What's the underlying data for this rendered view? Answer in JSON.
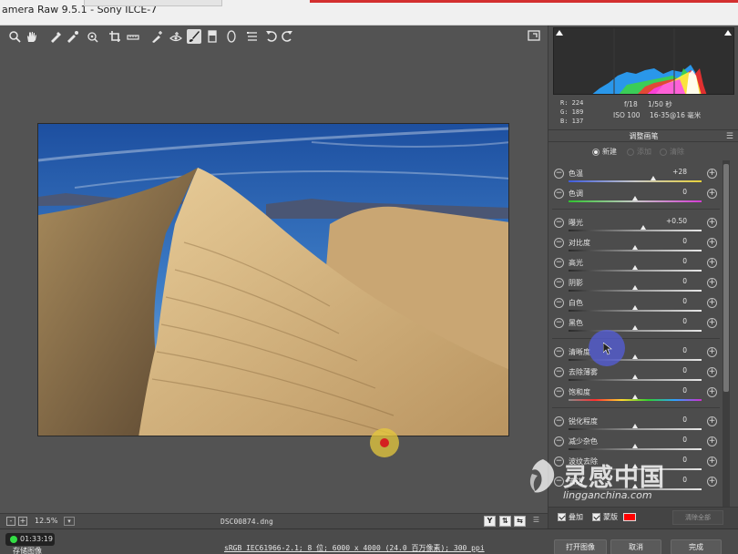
{
  "window": {
    "title": "amera Raw 9.5.1 - Sony ILCE-7"
  },
  "toolbar": {
    "tools": [
      "zoom-tool",
      "hand-tool",
      "white-balance-tool",
      "color-sampler-tool",
      "targeted-adjustment-tool",
      "crop-tool",
      "straighten-tool",
      "spot-removal-tool",
      "red-eye-tool",
      "adjustment-brush-tool",
      "graduated-filter-tool",
      "radial-filter-tool",
      "preferences-tool",
      "rotate-left-tool",
      "rotate-right-tool"
    ]
  },
  "histogram": {
    "rgb": {
      "r_label": "R:",
      "r": "224",
      "g_label": "G:",
      "g": "189",
      "b_label": "B:",
      "b": "137"
    },
    "camera": {
      "aperture": "f/18",
      "shutter": "1/50 秒",
      "iso": "ISO 100",
      "lens": "16-35@16 毫米"
    }
  },
  "panel": {
    "title": "调整画笔",
    "modes": [
      {
        "label": "新建",
        "selected": true
      },
      {
        "label": "添加",
        "selected": false
      },
      {
        "label": "清除",
        "selected": false
      }
    ],
    "groups": [
      [
        {
          "label": "色温",
          "value": "+28",
          "thumb": 0.64,
          "track": "temp"
        },
        {
          "label": "色调",
          "value": "0",
          "thumb": 0.5,
          "track": "tint"
        }
      ],
      [
        {
          "label": "曝光",
          "value": "+0.50",
          "thumb": 0.56,
          "track": "gray"
        },
        {
          "label": "对比度",
          "value": "0",
          "thumb": 0.5,
          "track": "gray"
        },
        {
          "label": "高光",
          "value": "0",
          "thumb": 0.5,
          "track": "gray"
        },
        {
          "label": "阴影",
          "value": "0",
          "thumb": 0.5,
          "track": "gray"
        },
        {
          "label": "白色",
          "value": "0",
          "thumb": 0.5,
          "track": "gray"
        },
        {
          "label": "黑色",
          "value": "0",
          "thumb": 0.5,
          "track": "gray"
        }
      ],
      [
        {
          "label": "清晰度",
          "value": "0",
          "thumb": 0.5,
          "track": "gray"
        },
        {
          "label": "去除薄雾",
          "value": "0",
          "thumb": 0.5,
          "track": "gray"
        },
        {
          "label": "饱和度",
          "value": "0",
          "thumb": 0.5,
          "track": "sat"
        }
      ],
      [
        {
          "label": "锐化程度",
          "value": "0",
          "thumb": 0.5,
          "track": "gray"
        },
        {
          "label": "减少杂色",
          "value": "0",
          "thumb": 0.5,
          "track": "gray"
        },
        {
          "label": "波纹去除",
          "value": "0",
          "thumb": 0.5,
          "track": "gray"
        },
        {
          "label": "去边",
          "value": "0",
          "thumb": 0.5,
          "track": "gray"
        }
      ]
    ],
    "bottom": {
      "overlay_label": "叠加",
      "mask_label": "蒙版",
      "mask_color": "#ff0000",
      "clear_all": "清除全部"
    }
  },
  "status": {
    "zoom": "12.5%",
    "filename": "DSC00874.dng",
    "zoom_out": "-",
    "zoom_in": "+"
  },
  "footer": {
    "timer": "01:33:19",
    "save_label": "存储图像",
    "workflow": "sRGB IEC61966-2.1; 8 位; 6000 x 4000 (24.0 百万像素); 300 ppi",
    "open": "打开图像",
    "cancel": "取消",
    "done": "完成"
  },
  "watermark": {
    "zh": "灵感中国",
    "en": "lingganchina.com"
  },
  "colors": {
    "panel_bg": "#4c4c4c",
    "canvas_bg": "#535353",
    "mask": "#ff0000",
    "brush_cursor": "#555fe6"
  }
}
